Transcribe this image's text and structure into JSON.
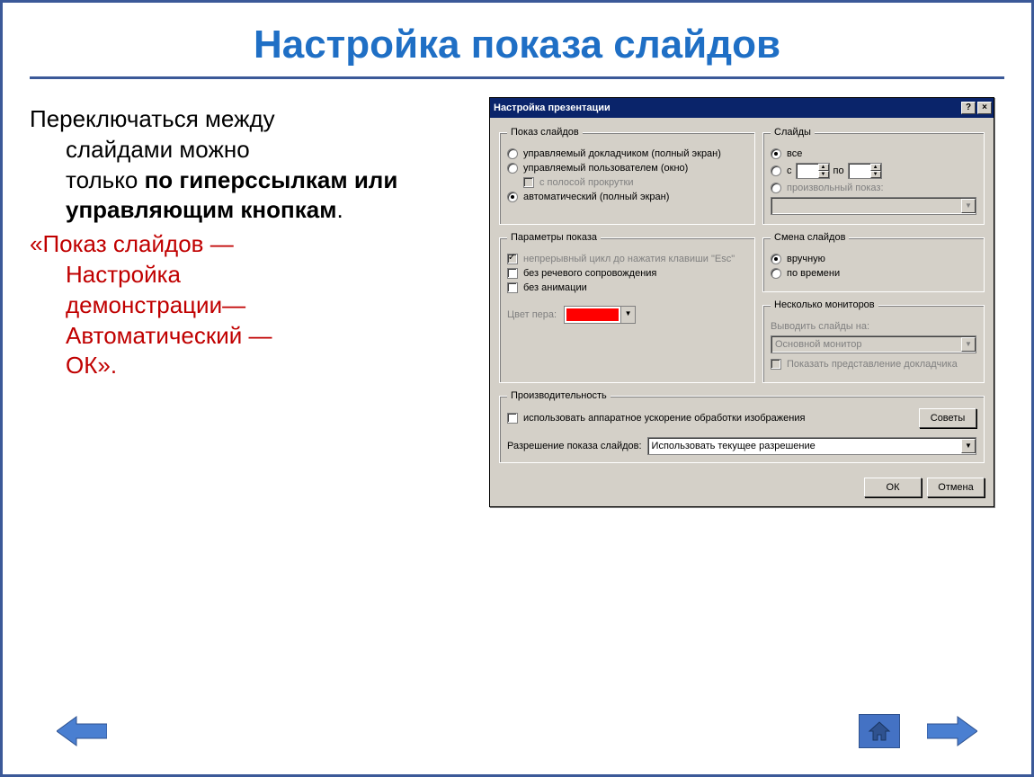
{
  "title": "Настройка показа слайдов",
  "leftText": {
    "line1a": "Переключаться между",
    "line1b": "слайдами можно",
    "line1c": "только ",
    "line1bold": "по гиперссылкам или управляющим кнопкам",
    "dot": ".",
    "line2a": "«Показ слайдов —",
    "line2b": "Настройка",
    "line2c": "демонстрации—",
    "line2d": "Автоматический —",
    "line2e": "ОК»."
  },
  "dialog": {
    "title": "Настройка презентации",
    "help": "?",
    "close": "×",
    "groups": {
      "show": {
        "legend": "Показ слайдов",
        "opt1": "управляемый докладчиком (полный экран)",
        "opt2": "управляемый пользователем (окно)",
        "opt2sub": "с полосой прокрутки",
        "opt3": "автоматический (полный экран)"
      },
      "slides": {
        "legend": "Слайды",
        "all": "все",
        "from": "с",
        "to": "по",
        "custom": "произвольный показ:"
      },
      "params": {
        "legend": "Параметры показа",
        "loop": "непрерывный цикл до нажатия клавиши \"Esc\"",
        "noNarration": "без речевого сопровождения",
        "noAnim": "без анимации",
        "penLabel": "Цвет пера:"
      },
      "advance": {
        "legend": "Смена слайдов",
        "manual": "вручную",
        "timed": "по времени"
      },
      "monitors": {
        "legend": "Несколько мониторов",
        "outLabel": "Выводить слайды на:",
        "primary": "Основной монитор",
        "presenter": "Показать представление докладчика"
      },
      "perf": {
        "legend": "Производительность",
        "hw": "использовать аппаратное ускорение обработки изображения",
        "tips": "Советы",
        "resLabel": "Разрешение показа слайдов:",
        "resVal": "Использовать текущее разрешение"
      }
    },
    "ok": "ОК",
    "cancel": "Отмена"
  }
}
